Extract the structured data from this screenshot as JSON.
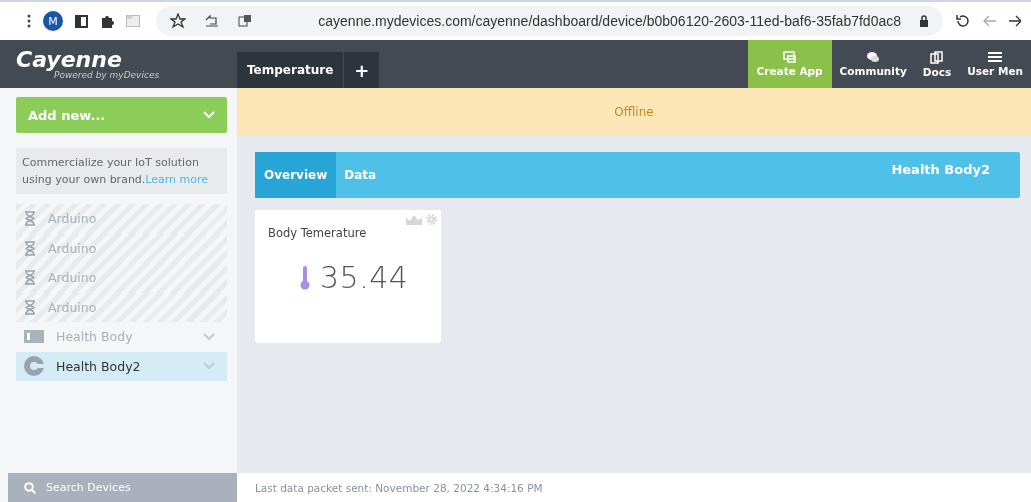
{
  "browser": {
    "url": "cayenne.mydevices.com/cayenne/dashboard/device/b0b06120-2603-11ed-baf6-35fab7fd0ac8",
    "profile": "M"
  },
  "header": {
    "logo": "Cayenne",
    "tagline": "Powered by myDevices",
    "project_tab": "Temperature",
    "add_tab": "+",
    "nav": [
      {
        "label": "Create App",
        "highlighted": true
      },
      {
        "label": "Community",
        "highlighted": false
      },
      {
        "label": "Docs",
        "highlighted": false
      },
      {
        "label": "User Men",
        "highlighted": false
      }
    ]
  },
  "sidebar": {
    "add_button": "Add new...",
    "promo": {
      "text": "Commercialize your IoT solution using your own brand.",
      "link": "Learn more"
    },
    "devices": [
      {
        "name": "Arduino",
        "kind": "pending",
        "selected": false
      },
      {
        "name": "Arduino",
        "kind": "pending",
        "selected": false
      },
      {
        "name": "Arduino",
        "kind": "pending",
        "selected": false
      },
      {
        "name": "Arduino",
        "kind": "pending",
        "selected": false
      },
      {
        "name": "Health Body",
        "kind": "board",
        "selected": false
      },
      {
        "name": "Health Body2",
        "kind": "custom",
        "selected": true
      }
    ],
    "search": "Search Devices"
  },
  "status_banner": "Offline",
  "device_tabs": [
    {
      "label": "Overview",
      "selected": true
    },
    {
      "label": "Data",
      "selected": false
    }
  ],
  "device_name": "Health Body2",
  "widgets": [
    {
      "title": "Body Temerature",
      "value": "35.44"
    }
  ],
  "footer": "Last data packet sent: November 28, 2022 4:34:16 PM"
}
